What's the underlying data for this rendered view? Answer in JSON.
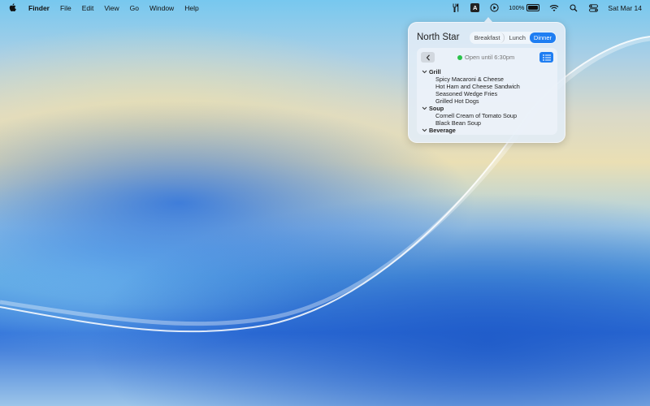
{
  "menubar": {
    "apple_icon": "apple-logo-icon",
    "app_name": "Finder",
    "menus": [
      "File",
      "Edit",
      "View",
      "Go",
      "Window",
      "Help"
    ],
    "status_icons": {
      "utensils": "fork-knife-icon",
      "input_badge": "A",
      "play": "play-circle-icon",
      "battery_percent": "100%",
      "battery_level": 1.0,
      "wifi": "wifi-icon",
      "search": "search-icon",
      "control_center": "control-center-icon"
    },
    "clock": "Sat Mar 14"
  },
  "popover": {
    "title": "North Star",
    "segments": [
      "Breakfast",
      "Lunch",
      "Dinner"
    ],
    "selected_segment": "Dinner",
    "status_text": "Open until 6:30pm",
    "status_color": "#2bc24a",
    "accent_color": "#1f7ef2",
    "categories": [
      {
        "name": "Grill",
        "items": [
          "Spicy Macaroni & Cheese",
          "Hot Ham and Cheese Sandwich",
          "Seasoned Wedge Fries",
          "Grilled Hot Dogs"
        ]
      },
      {
        "name": "Soup",
        "items": [
          "Cornell Cream of Tomato Soup",
          "Black Bean Soup"
        ]
      },
      {
        "name": "Beverage",
        "items": []
      }
    ]
  }
}
